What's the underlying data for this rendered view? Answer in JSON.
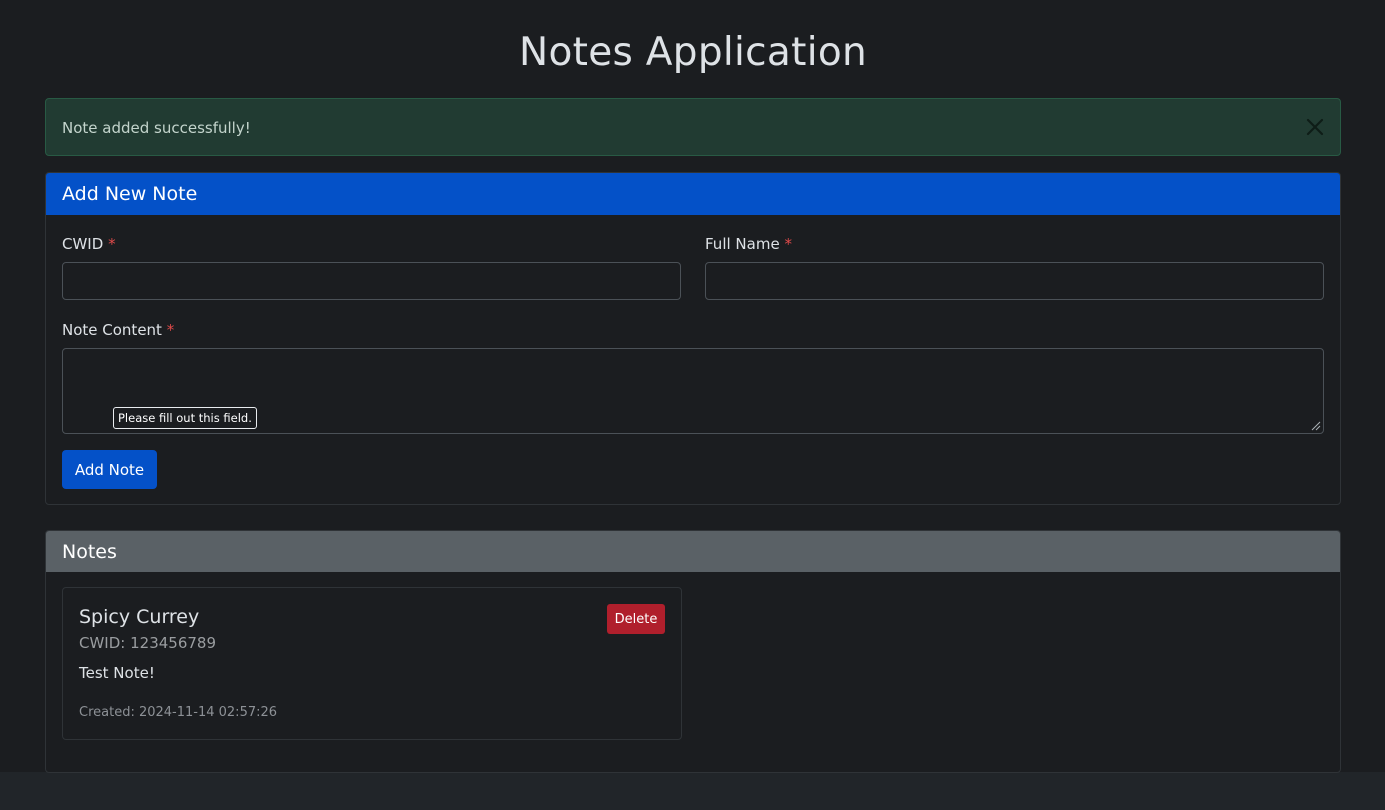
{
  "page": {
    "title": "Notes Application"
  },
  "alert": {
    "message": "Note added successfully!",
    "close_icon": "close-icon"
  },
  "form": {
    "header": "Add New Note",
    "cwid_label": "CWID",
    "full_name_label": "Full Name",
    "note_content_label": "Note Content",
    "required_mark": "*",
    "cwid_value": "",
    "full_name_value": "",
    "note_content_value": "",
    "validation_tooltip": "Please fill out this field.",
    "submit_label": "Add Note"
  },
  "notes": {
    "header": "Notes",
    "items": [
      {
        "name": "Spicy Currey",
        "cwid": "CWID: 123456789",
        "content": "Test Note!",
        "created": "Created: 2024-11-14 02:57:26",
        "delete_label": "Delete"
      }
    ]
  },
  "colors": {
    "primary": "#0451c8",
    "danger": "#b01f2c",
    "success_bg": "#213b32",
    "secondary_header": "#5a6166",
    "required": "#e04a4a"
  }
}
